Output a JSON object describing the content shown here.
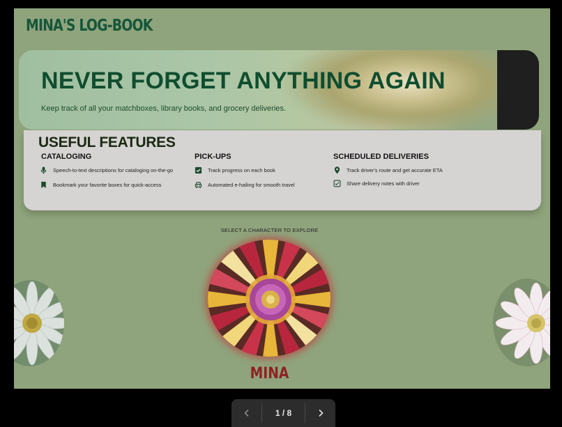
{
  "brand": "MINA'S LOG-BOOK",
  "hero": {
    "title": "NEVER FORGET ANYTHING AGAIN",
    "subtitle": "Keep track of all your matchboxes, library books, and grocery deliveries."
  },
  "features": {
    "title": "USEFUL FEATURES",
    "columns": [
      {
        "title": "CATALOGING",
        "items": [
          {
            "icon": "microphone-icon",
            "text": "Speech-to-text descriptions for cataloging on-the-go"
          },
          {
            "icon": "bookmark-icon",
            "text": "Bookmark your favorite boxes for quick-access"
          }
        ]
      },
      {
        "title": "PICK-UPS",
        "items": [
          {
            "icon": "checkbox-icon",
            "text": "Track progress on each book"
          },
          {
            "icon": "car-icon",
            "text": "Automated e-hailing for smooth travel"
          }
        ]
      },
      {
        "title": "SCHEDULED DELIVERIES",
        "items": [
          {
            "icon": "location-pin-icon",
            "text": "Track driver's route and get accurate ETA"
          },
          {
            "icon": "note-icon",
            "text": "Share delivery notes with driver"
          }
        ]
      }
    ]
  },
  "characters": {
    "prompt": "SELECT A CHARACTER TO EXPLORE",
    "selected_name": "MINA"
  },
  "pager": {
    "label": "1 / 8",
    "current": 1,
    "total": 8
  },
  "colors": {
    "background": "#8fa47c",
    "brand": "#16563a",
    "hero_title": "#0f4d2f",
    "character_name": "#8e2222",
    "selection_glow": "#c82832"
  }
}
